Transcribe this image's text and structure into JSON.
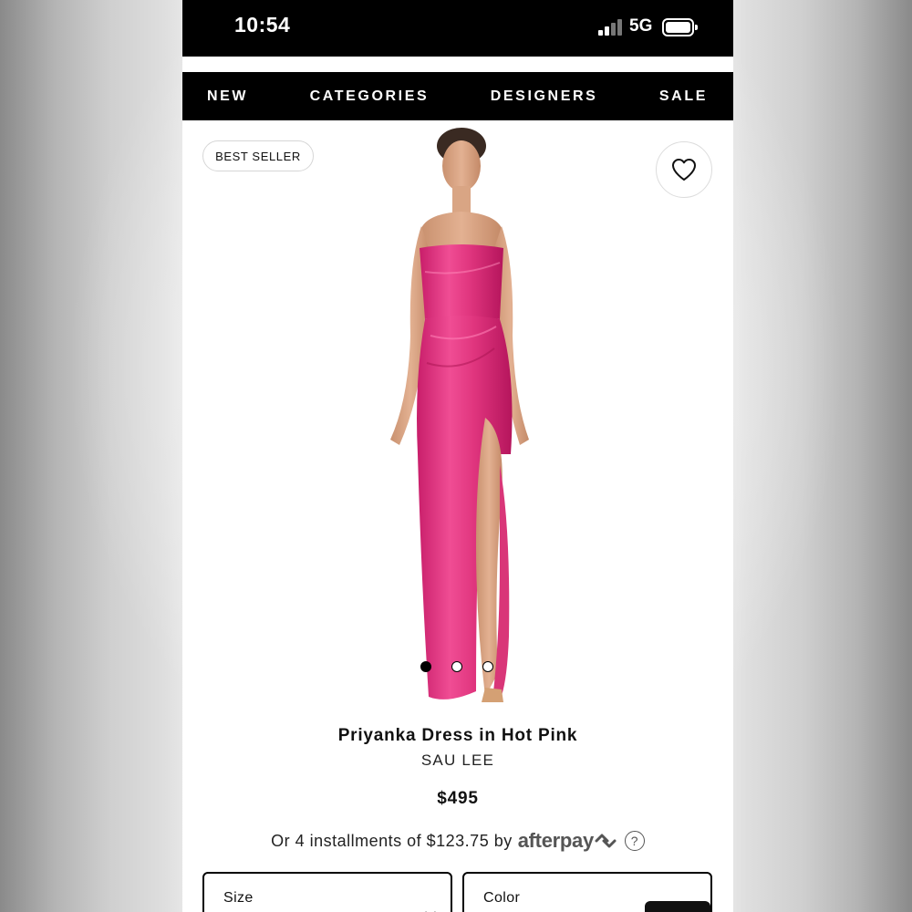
{
  "status_bar": {
    "time": "10:54",
    "network": "5G",
    "signal_bars_active": 2,
    "signal_bars_total": 4,
    "battery_level": 0.9
  },
  "nav": {
    "items": [
      "NEW",
      "CATEGORIES",
      "DESIGNERS",
      "SALE"
    ]
  },
  "product": {
    "badge": "BEST SELLER",
    "name": "Priyanka Dress in Hot Pink",
    "brand": "SAU LEE",
    "price": "$495",
    "image_icon": "hot-pink-gown-photo",
    "carousel_total": 3,
    "carousel_active": 1,
    "accent_color": "#e0357e"
  },
  "installments": {
    "prefix": "Or 4 installments of $123.75 by",
    "provider": "afterpay",
    "help": "?"
  },
  "selectors": {
    "size_label": "Size",
    "color_label": "Color"
  },
  "icons": {
    "wishlist": "heart-icon",
    "help": "question-icon",
    "afterpay_mark": "afterpay-arrows-icon"
  }
}
